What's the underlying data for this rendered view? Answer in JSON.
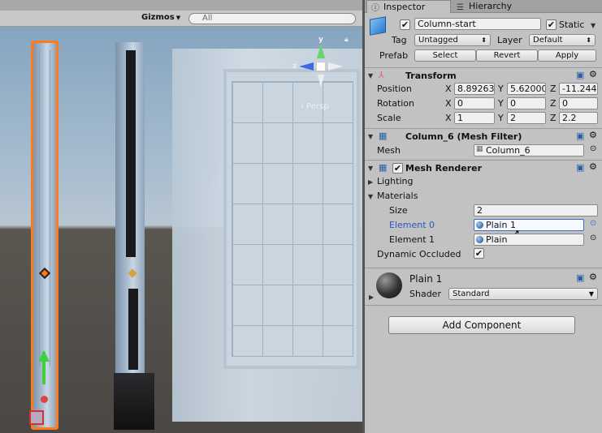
{
  "scene": {
    "gizmos_label": "Gizmos",
    "search_placeholder": "All",
    "persp_label": "‹ Persp",
    "axis_y": "y",
    "axis_z": "z"
  },
  "tabs": {
    "inspector": "Inspector",
    "hierarchy": "Hierarchy"
  },
  "object": {
    "name": "Column-start",
    "static_label": "Static",
    "tag_label": "Tag",
    "tag_value": "Untagged",
    "layer_label": "Layer",
    "layer_value": "Default",
    "prefab_label": "Prefab",
    "select_label": "Select",
    "revert_label": "Revert",
    "apply_label": "Apply"
  },
  "transform": {
    "title": "Transform",
    "position_label": "Position",
    "rotation_label": "Rotation",
    "scale_label": "Scale",
    "x": "X",
    "y": "Y",
    "z": "Z",
    "position": [
      "8.89263",
      "5.62000",
      "-11.244"
    ],
    "rotation": [
      "0",
      "0",
      "0"
    ],
    "scale": [
      "1",
      "2",
      "2.2"
    ]
  },
  "mesh_filter": {
    "title": "Column_6 (Mesh Filter)",
    "mesh_label": "Mesh",
    "mesh_value": "Column_6"
  },
  "mesh_renderer": {
    "title": "Mesh Renderer",
    "lighting_label": "Lighting",
    "materials_label": "Materials",
    "size_label": "Size",
    "size_value": "2",
    "element0_label": "Element 0",
    "element0_value": "Plain 1",
    "element1_label": "Element 1",
    "element1_value": "Plain",
    "occluded_label": "Dynamic Occluded"
  },
  "material": {
    "name": "Plain 1",
    "shader_label": "Shader",
    "shader_value": "Standard"
  },
  "add_component_label": "Add Component",
  "colors": {
    "selection_outline": "#ff7a1a",
    "selected_field": "#3c6cc7"
  }
}
